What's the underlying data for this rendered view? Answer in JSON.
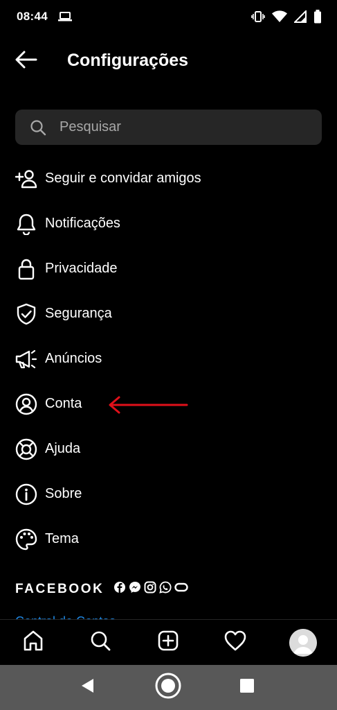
{
  "status_bar": {
    "time": "08:44"
  },
  "header": {
    "title": "Configurações"
  },
  "search": {
    "placeholder": "Pesquisar"
  },
  "menu": [
    {
      "label": "Seguir e convidar amigos",
      "icon": "add-person-icon"
    },
    {
      "label": "Notificações",
      "icon": "bell-icon"
    },
    {
      "label": "Privacidade",
      "icon": "lock-icon"
    },
    {
      "label": "Segurança",
      "icon": "shield-check-icon"
    },
    {
      "label": "Anúncios",
      "icon": "megaphone-icon"
    },
    {
      "label": "Conta",
      "icon": "account-circle-icon"
    },
    {
      "label": "Ajuda",
      "icon": "lifebuoy-icon"
    },
    {
      "label": "Sobre",
      "icon": "info-icon"
    },
    {
      "label": "Tema",
      "icon": "palette-icon"
    }
  ],
  "facebook": {
    "title": "FACEBOOK",
    "link": "Central de Contas"
  },
  "colors": {
    "background": "#000000",
    "search_bg": "#262626",
    "link": "#1e88e5",
    "annotation_arrow": "#e0101a",
    "android_nav": "#585858"
  },
  "bottom_nav": [
    "home-icon",
    "search-icon",
    "new-post-icon",
    "heart-icon",
    "profile-avatar"
  ],
  "android_nav": [
    "back-triangle-icon",
    "home-circle-icon",
    "recents-square-icon"
  ]
}
